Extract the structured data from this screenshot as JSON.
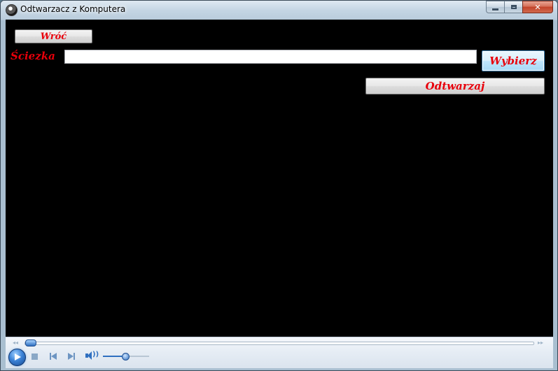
{
  "window": {
    "title": "Odtwarzacz z Komputera"
  },
  "form": {
    "back_label": "Wróć",
    "path_label": "Ściezka",
    "path_value": "",
    "choose_label": "Wybierz",
    "play_label": "Odtwarzaj"
  },
  "media_player": {
    "seek_position": 0.0,
    "volume_level": 0.5,
    "icons": [
      "play-icon",
      "stop-icon",
      "previous-icon",
      "next-icon",
      "volume-icon"
    ]
  },
  "colors": {
    "label_red": "#e8000b",
    "client_background": "#000000",
    "accent_blue": "#2f6fc0"
  }
}
